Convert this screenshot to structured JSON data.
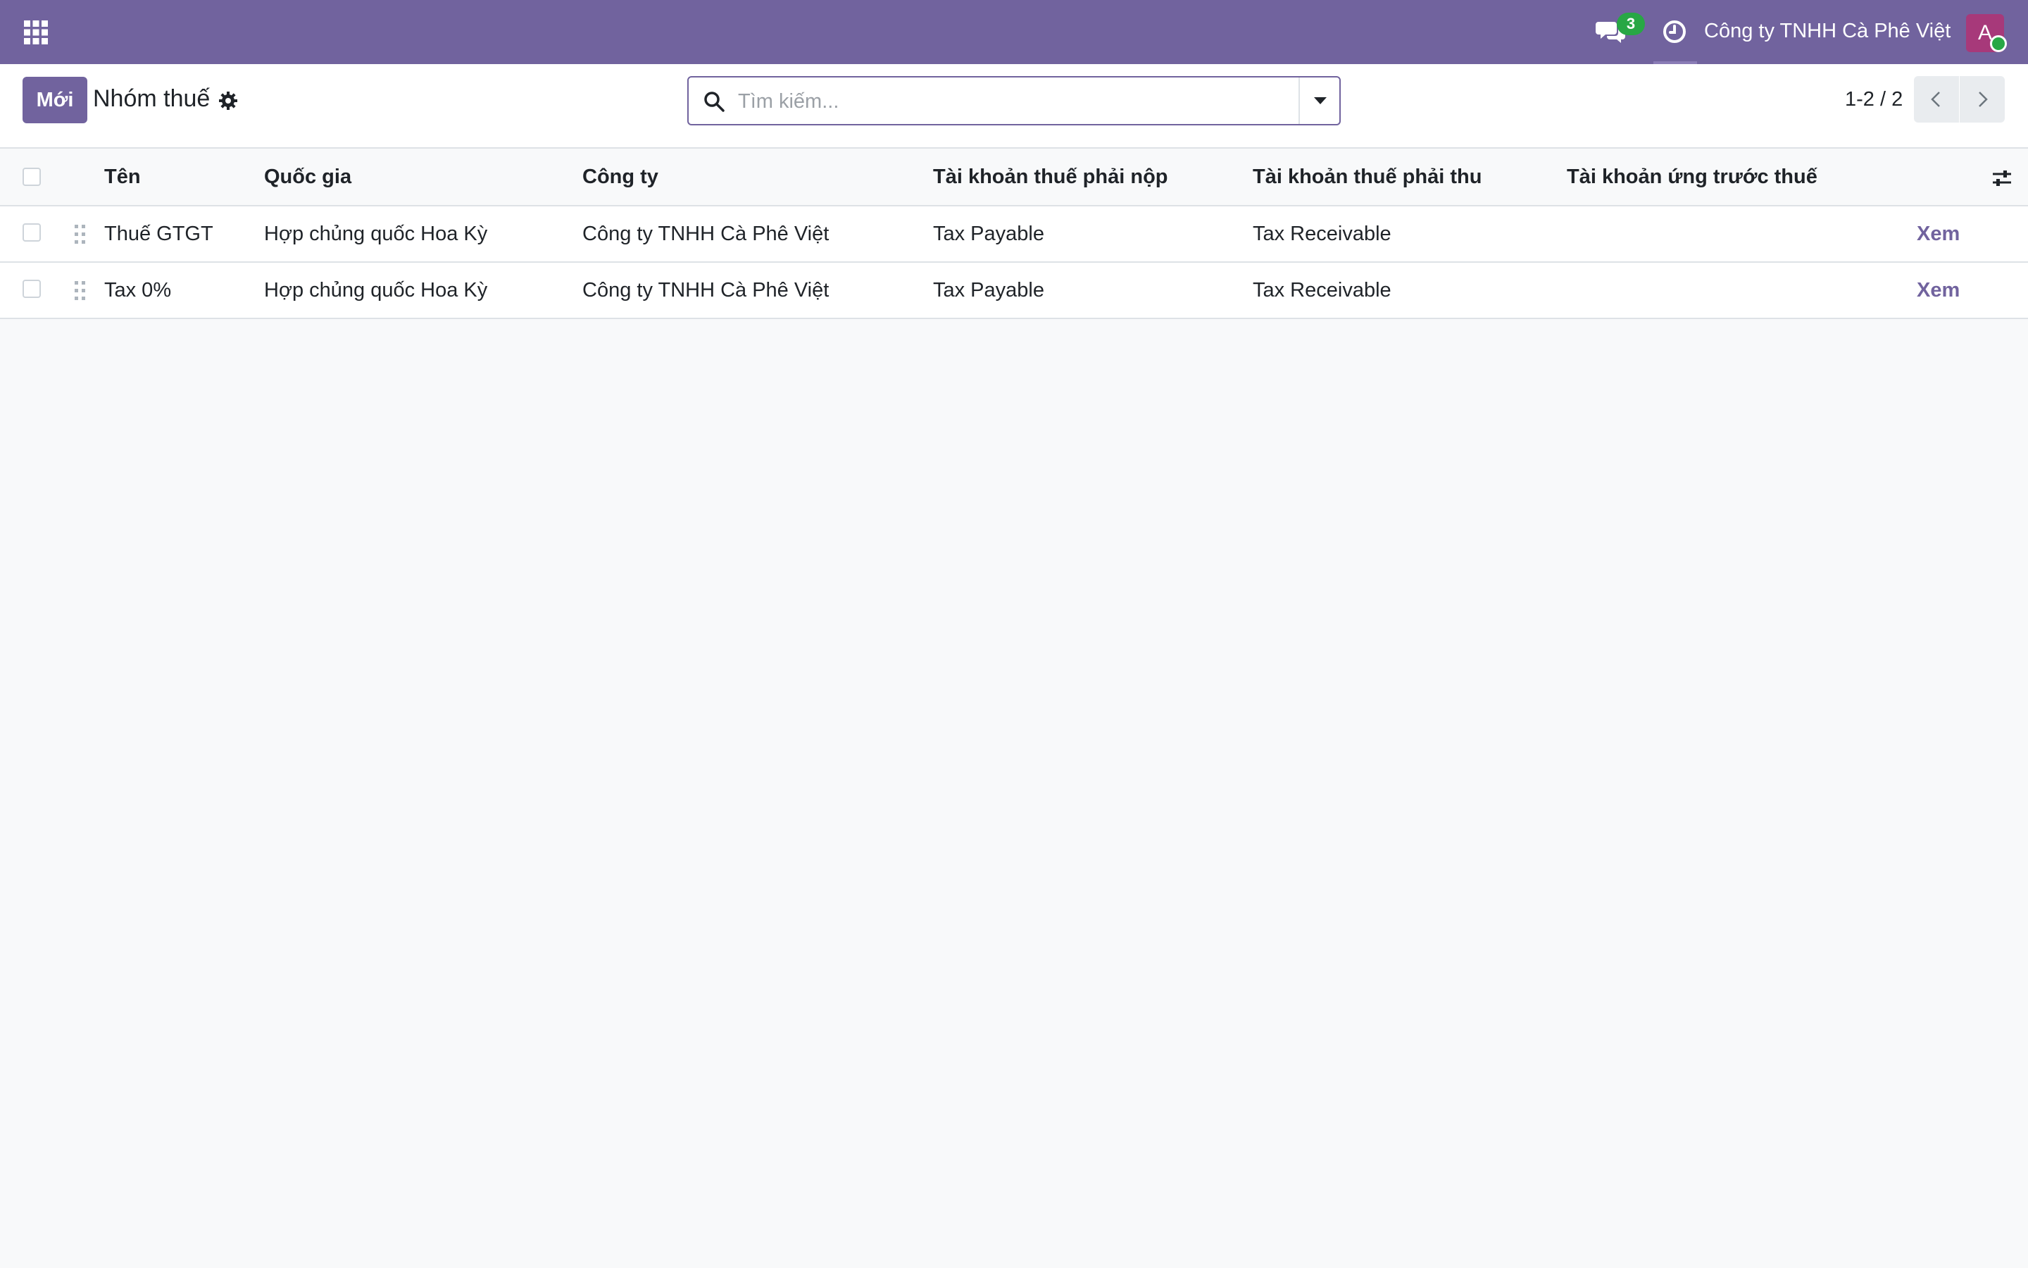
{
  "navbar": {
    "unread_count": "3",
    "company_name": "Công ty TNHH Cà Phê Việt",
    "avatar_initial": "A",
    "brand_color": "#71639e"
  },
  "control_panel": {
    "new_label": "Mới",
    "title": "Nhóm thuế",
    "search_placeholder": "Tìm kiếm...",
    "pager_value": "1-2 / 2"
  },
  "table": {
    "headers": {
      "name": "Tên",
      "country": "Quốc gia",
      "company": "Công ty",
      "payable": "Tài khoản thuế phải nộp",
      "receivable": "Tài khoản thuế phải thu",
      "advance": "Tài khoản ứng trước thuế"
    },
    "rows": [
      {
        "name": "Thuế GTGT",
        "country": "Hợp chủng quốc Hoa Kỳ",
        "company": "Công ty TNHH Cà Phê Việt",
        "payable": "Tax Payable",
        "receivable": "Tax Receivable",
        "advance": "",
        "action": "Xem"
      },
      {
        "name": "Tax 0%",
        "country": "Hợp chủng quốc Hoa Kỳ",
        "company": "Công ty TNHH Cà Phê Việt",
        "payable": "Tax Payable",
        "receivable": "Tax Receivable",
        "advance": "",
        "action": "Xem"
      }
    ]
  }
}
